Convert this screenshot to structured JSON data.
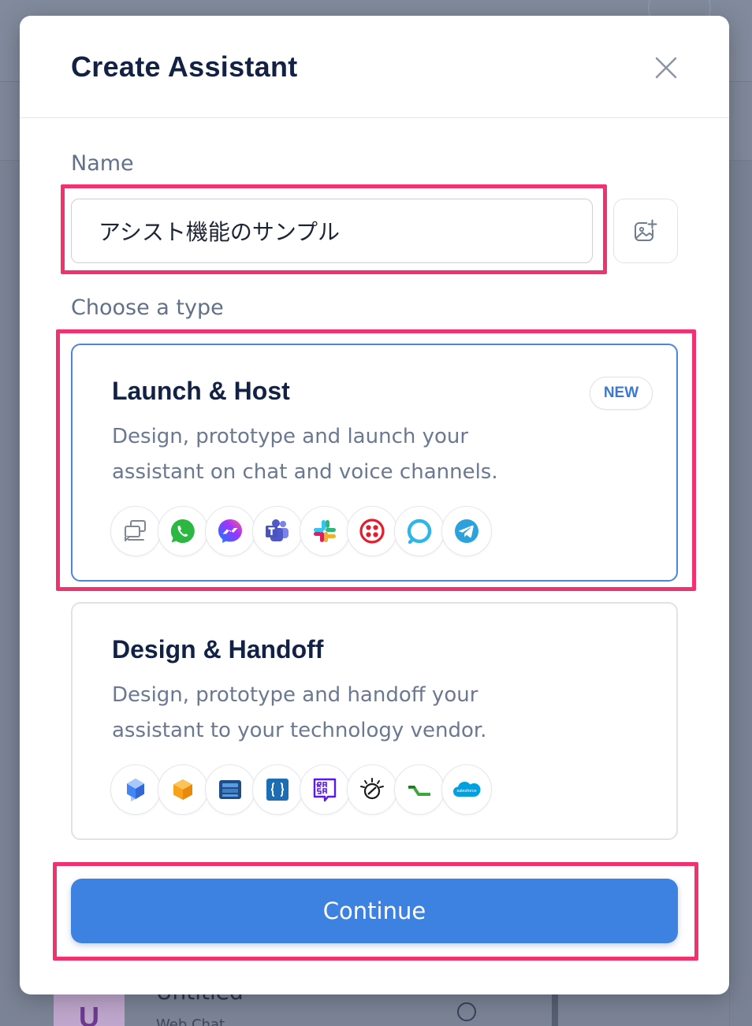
{
  "background": {
    "item_avatar_letter": "U",
    "item_title": "Untitled",
    "item_subtitle": "Web Chat"
  },
  "modal": {
    "title": "Create Assistant",
    "close_icon": "close-icon"
  },
  "name_field": {
    "label": "Name",
    "value": "アシスト機能のサンプル",
    "image_button_icon": "add-image-icon"
  },
  "type_section": {
    "label": "Choose a type",
    "options": [
      {
        "title": "Launch & Host",
        "badge": "NEW",
        "description_line1": "Design, prototype and launch your",
        "description_line2": "assistant on chat and voice channels.",
        "selected": true,
        "icons": [
          "web-chat-icon",
          "whatsapp-icon",
          "messenger-icon",
          "teams-icon",
          "slack-icon",
          "twilio-icon",
          "alexa-icon",
          "telegram-icon"
        ]
      },
      {
        "title": "Design & Handoff",
        "description_line1": "Design, prototype and handoff your",
        "description_line2": "assistant to your technology vendor.",
        "selected": false,
        "icons": [
          "dialogflow-icon",
          "lex-icon",
          "nuance-icon",
          "json-icon",
          "rasa-icon",
          "watson-icon",
          "kore-icon",
          "salesforce-icon"
        ]
      }
    ]
  },
  "actions": {
    "continue_label": "Continue"
  },
  "colors": {
    "accent": "#3d82e0",
    "selected_border": "#4a86dc",
    "highlight": "#f0336e",
    "title_text": "#132144"
  }
}
